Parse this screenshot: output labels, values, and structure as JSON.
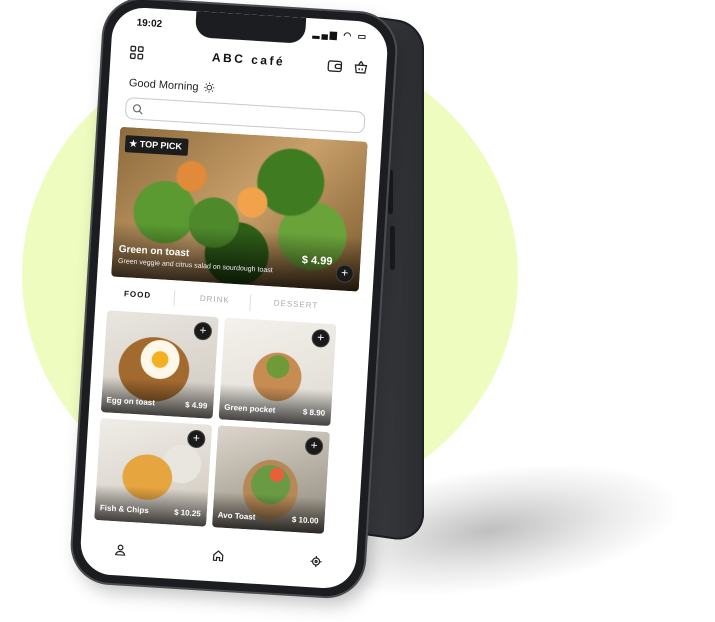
{
  "status_bar": {
    "time": "19:02",
    "icons": "▂▄▆ ◠ ▭"
  },
  "header": {
    "title": "ABC café",
    "menu_icon": "grid-icon",
    "wallet_icon": "wallet-icon",
    "basket_icon": "basket-icon"
  },
  "greeting": {
    "text": "Good Morning",
    "icon": "sun-icon"
  },
  "search": {
    "placeholder": "",
    "value": ""
  },
  "hero": {
    "badge": "TOP PICK",
    "name": "Green on toast",
    "description": "Green veggie and citrus salad on sourdough toast",
    "price": "$ 4.99",
    "add_label": "+"
  },
  "tabs": [
    {
      "label": "FOOD",
      "active": true
    },
    {
      "label": "DRINK",
      "active": false
    },
    {
      "label": "DESSERT",
      "active": false
    }
  ],
  "items": [
    {
      "name": "Egg on toast",
      "price": "$ 4.99",
      "add_label": "+"
    },
    {
      "name": "Green pocket",
      "price": "$ 8.90",
      "add_label": "+"
    },
    {
      "name": "Fish & Chips",
      "price": "$ 10.25",
      "add_label": "+"
    },
    {
      "name": "Avo Toast",
      "price": "$ 10.00",
      "add_label": "+"
    }
  ],
  "bottom_nav": [
    {
      "icon": "user-icon"
    },
    {
      "icon": "home-icon"
    },
    {
      "icon": "location-icon"
    }
  ],
  "colors": {
    "accent_blob": "#eefcc0",
    "phone_body": "#1c1d20",
    "screen": "#ffffff"
  }
}
